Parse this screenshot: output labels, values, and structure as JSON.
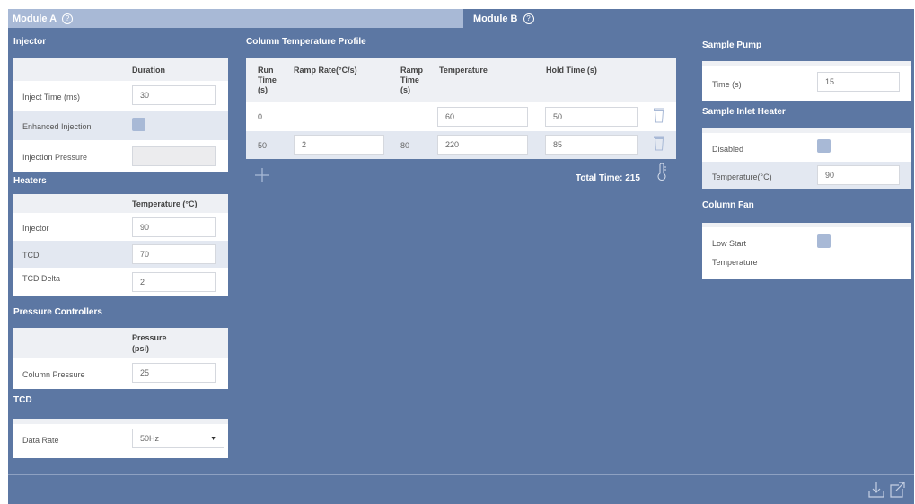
{
  "tabs": [
    {
      "label": "Module A",
      "help_icon": "question-circle-icon"
    },
    {
      "label": "Module B",
      "help_icon": "question-circle-icon"
    }
  ],
  "injector": {
    "title": "Injector",
    "column_header": "Duration",
    "rows": [
      {
        "label": "Inject Time (ms)",
        "value": "30"
      },
      {
        "label": "Enhanced Injection",
        "checkbox": true
      },
      {
        "label": "Injection Pressure",
        "value": ""
      }
    ]
  },
  "heaters": {
    "title": "Heaters",
    "column_header": "Temperature (°C)",
    "rows": [
      {
        "label": "Injector",
        "value": "90"
      },
      {
        "label": "TCD",
        "value": "70"
      },
      {
        "label": "TCD Delta",
        "value": "2"
      }
    ]
  },
  "pressure": {
    "title": "Pressure Controllers",
    "column_header_line1": "Pressure",
    "column_header_line2": "(psi)",
    "rows": [
      {
        "label": "Column Pressure",
        "value": "25"
      }
    ]
  },
  "tcd": {
    "title": "TCD",
    "rows": [
      {
        "label": "Data Rate",
        "value": "50Hz"
      }
    ]
  },
  "profile": {
    "title": "Column Temperature Profile",
    "headers": {
      "run_time": [
        "Run",
        "Time",
        "(s)"
      ],
      "ramp_rate": "Ramp Rate(°C/s)",
      "ramp_time": [
        "Ramp",
        "Time",
        "(s)"
      ],
      "temperature": "Temperature",
      "hold_time": "Hold Time (s)"
    },
    "rows": [
      {
        "run_time": "0",
        "ramp_rate": "",
        "ramp_time": "",
        "temperature": "60",
        "hold_time": "50"
      },
      {
        "run_time": "50",
        "ramp_rate": "2",
        "ramp_time": "80",
        "temperature": "220",
        "hold_time": "85"
      }
    ],
    "total_label": "Total Time: 215",
    "add_icon": "plus-icon",
    "thermometer_icon": "thermometer-icon"
  },
  "sample_pump": {
    "title": "Sample Pump",
    "rows": [
      {
        "label": "Time (s)",
        "value": "15"
      }
    ]
  },
  "sample_inlet": {
    "title": "Sample Inlet Heater",
    "rows": [
      {
        "label": "Disabled",
        "checkbox": true
      },
      {
        "label": "Temperature(°C)",
        "value": "90"
      }
    ]
  },
  "column_fan": {
    "title": "Column Fan",
    "label_line1": "Low Start",
    "label_line2": "Temperature",
    "checkbox": true
  },
  "footer": {
    "download_icon": "download-icon",
    "export_icon": "external-link-icon"
  },
  "colors": {
    "background": "#5c77a3",
    "tab_inactive": "#a8b9d6",
    "checkbox": "#a8b9d6",
    "row_alt": "#e3e8f1"
  }
}
